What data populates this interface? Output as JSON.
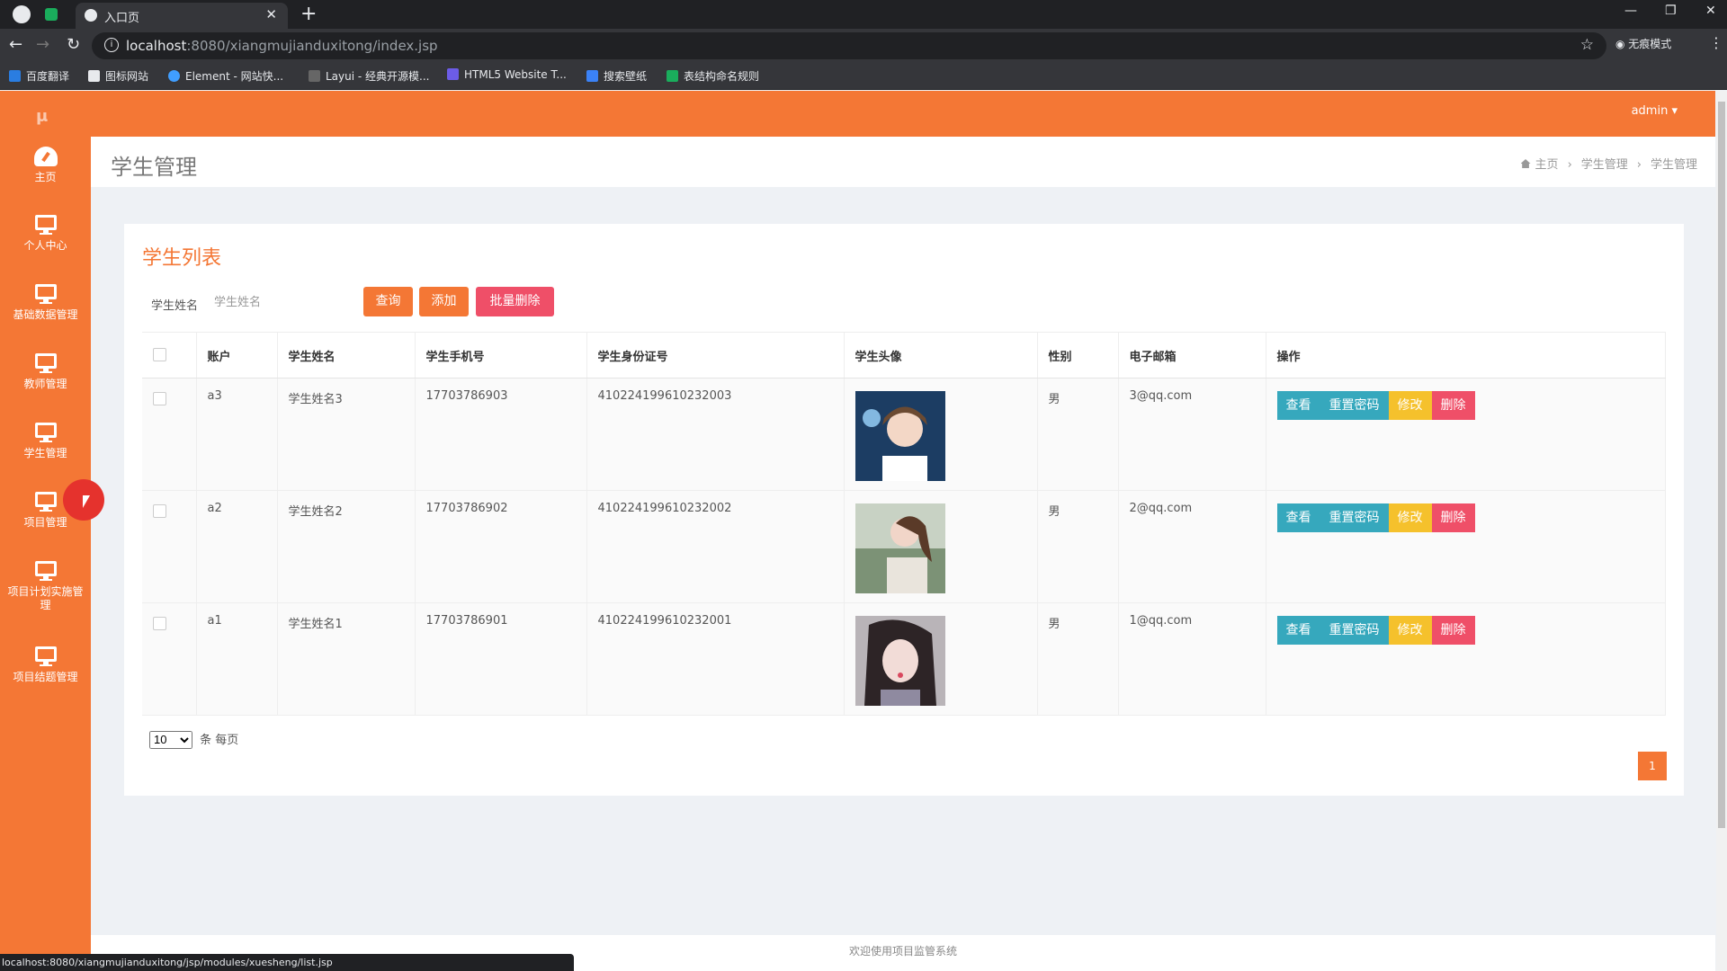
{
  "browser": {
    "tab_title": "入口页",
    "url_host": "localhost",
    "url_path": ":8080/xiangmujianduxitong/index.jsp",
    "incognito_label": "无痕模式",
    "bookmarks": [
      "百度翻译",
      "图标网站",
      "Element - 网站快...",
      "Layui - 经典开源模...",
      "HTML5 Website T...",
      "搜索壁纸",
      "表结构命名规则"
    ],
    "status_url": "localhost:8080/xiangmujianduxitong/jsp/modules/xuesheng/list.jsp"
  },
  "colors": {
    "brand": "#f47735",
    "info": "#36a8bd",
    "warning": "#f5c12c",
    "danger": "#ef4f68"
  },
  "header": {
    "user": "admin"
  },
  "sidebar": {
    "items": [
      {
        "label": "主页",
        "icon": "dashboard-icon"
      },
      {
        "label": "个人中心",
        "icon": "monitor-icon"
      },
      {
        "label": "基础数据管理",
        "icon": "monitor-icon"
      },
      {
        "label": "教师管理",
        "icon": "monitor-icon"
      },
      {
        "label": "学生管理",
        "icon": "monitor-icon"
      },
      {
        "label": "项目管理",
        "icon": "monitor-icon"
      },
      {
        "label": "项目计划实施管理",
        "icon": "monitor-icon"
      },
      {
        "label": "项目结题管理",
        "icon": "monitor-icon"
      }
    ]
  },
  "page": {
    "title": "学生管理",
    "breadcrumb": [
      "主页",
      "学生管理",
      "学生管理"
    ]
  },
  "panel": {
    "title": "学生列表",
    "filter_label": "学生姓名",
    "filter_placeholder": "学生姓名",
    "btn_query": "查询",
    "btn_add": "添加",
    "btn_batch_delete": "批量删除"
  },
  "table": {
    "headers": [
      "账户",
      "学生姓名",
      "学生手机号",
      "学生身份证号",
      "学生头像",
      "性别",
      "电子邮箱",
      "操作"
    ],
    "rows": [
      {
        "account": "a3",
        "name": "学生姓名3",
        "phone": "17703786903",
        "idcard": "410224199610232003",
        "gender": "男",
        "email": "3@qq.com"
      },
      {
        "account": "a2",
        "name": "学生姓名2",
        "phone": "17703786902",
        "idcard": "410224199610232002",
        "gender": "男",
        "email": "2@qq.com"
      },
      {
        "account": "a1",
        "name": "学生姓名1",
        "phone": "17703786901",
        "idcard": "410224199610232001",
        "gender": "男",
        "email": "1@qq.com"
      }
    ],
    "actions": {
      "view": "查看",
      "reset": "重置密码",
      "edit": "修改",
      "delete": "删除"
    }
  },
  "pagination": {
    "page_size": "10",
    "per_page_label": "条 每页",
    "current_page": "1"
  },
  "footer": {
    "text": "欢迎使用项目监管系统"
  }
}
